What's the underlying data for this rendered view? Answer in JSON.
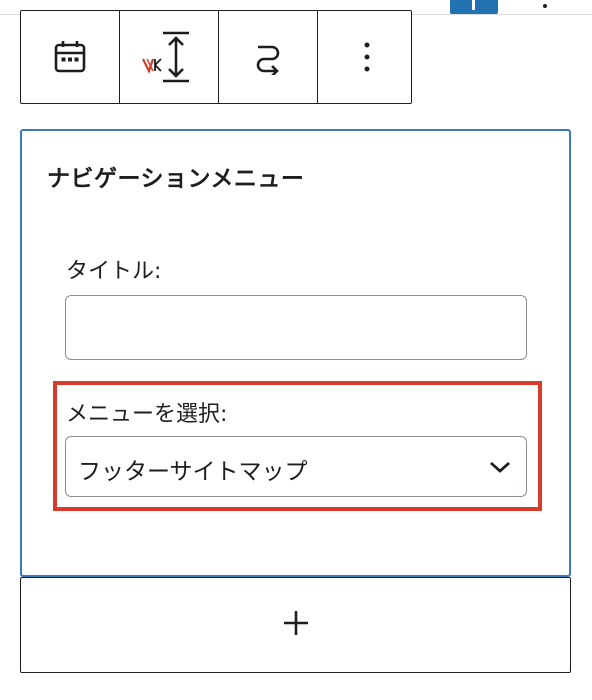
{
  "toolbar": {
    "buttons": [
      {
        "name": "calendar-icon"
      },
      {
        "name": "vertical-spacing-icon"
      },
      {
        "name": "loop-arrow-icon"
      },
      {
        "name": "more-options-icon"
      }
    ]
  },
  "widget": {
    "title": "ナビゲーションメニュー",
    "title_label": "タイトル:",
    "title_value": "",
    "menu_label": "メニューを選択:",
    "menu_selected": "フッターサイトマップ"
  },
  "add_block": {
    "icon": "plus-icon"
  },
  "colors": {
    "accent_blue": "#2271b1",
    "widget_border": "#3a7bbd",
    "highlight_red": "#d63b2b",
    "vk_mark_red": "#d63b2b"
  }
}
